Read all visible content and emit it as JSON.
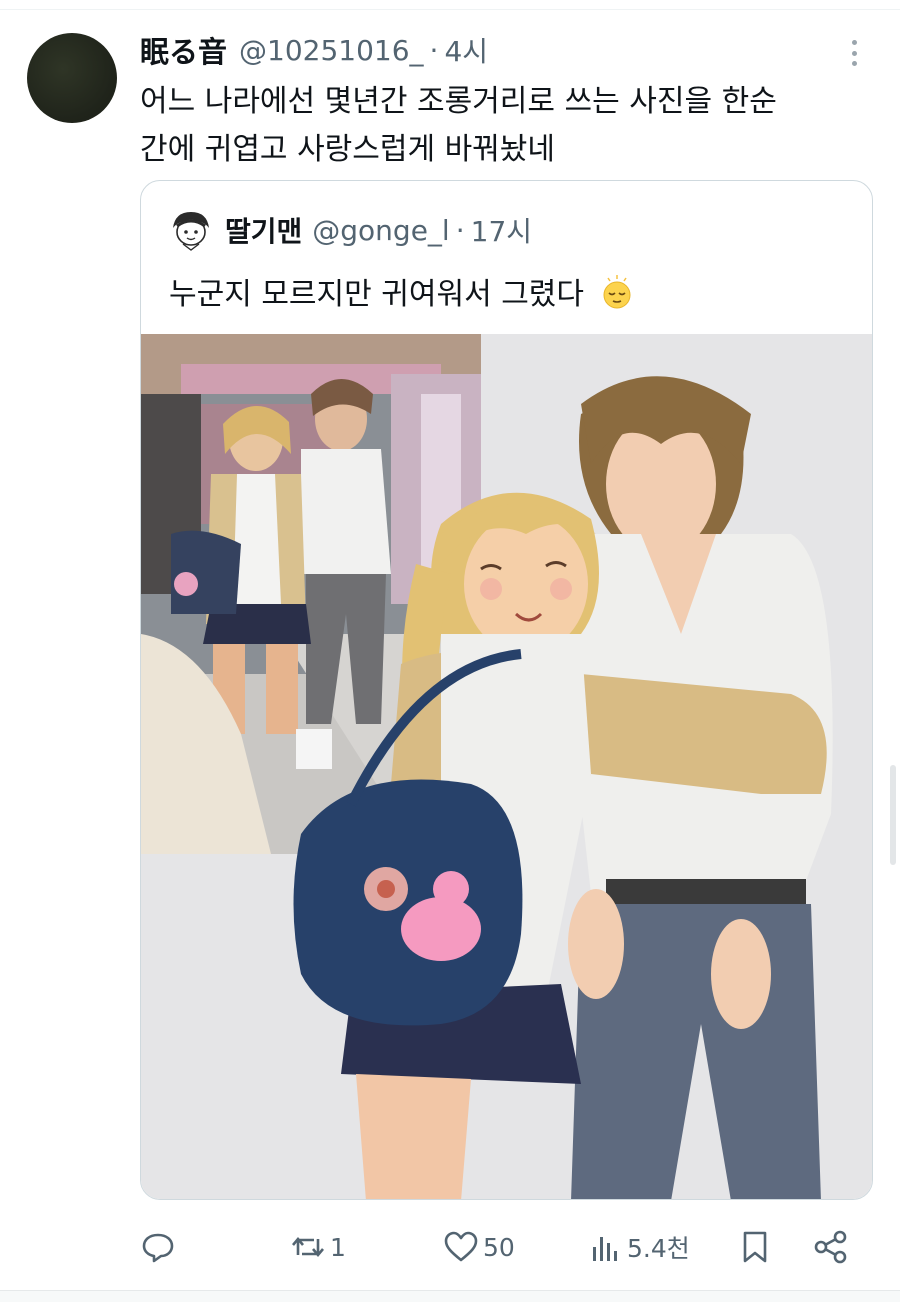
{
  "tweet": {
    "author_name": "眠る音",
    "author_handle": "@10251016_",
    "separator": "·",
    "time": "4시",
    "text_lines": [
      "어느 나라에선 몇년간 조롱거리로 쓰는 사진을 한순",
      "간에 귀엽고 사랑스럽게 바꿔놨네"
    ]
  },
  "quote": {
    "author_name": "딸기맨",
    "author_handle": "@gonge_l",
    "separator": "·",
    "time": "17시",
    "text": "누군지 모르지만 귀여워서 그렸다"
  },
  "actions": {
    "replies": "",
    "retweets": "1",
    "likes": "50",
    "views": "5.4천"
  },
  "icons": {
    "reply": "reply-icon",
    "retweet": "retweet-icon",
    "like": "heart-icon",
    "views": "views-icon",
    "bookmark": "bookmark-icon",
    "share": "share-icon",
    "more": "more-icon",
    "emoji": "relieved-face-icon"
  },
  "colors": {
    "text_primary": "#0f1419",
    "text_secondary": "#536471",
    "card_border": "#cfd9de",
    "media_bg": "#e5e5e7"
  }
}
